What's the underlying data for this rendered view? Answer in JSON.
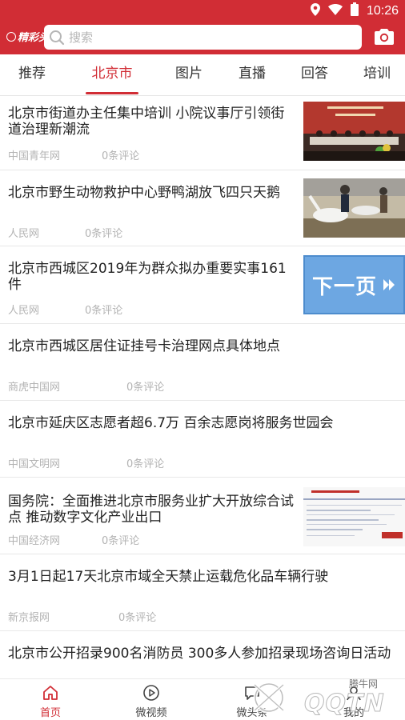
{
  "status_bar": {
    "time": "10:26"
  },
  "header": {
    "logo_text": "精彩头条",
    "search_placeholder": "搜索"
  },
  "tabs": [
    {
      "label": "推荐",
      "active": false
    },
    {
      "label": "北京市",
      "active": true
    },
    {
      "label": "图片",
      "active": false
    },
    {
      "label": "直播",
      "active": false
    },
    {
      "label": "回答",
      "active": false
    },
    {
      "label": "培训",
      "active": false
    }
  ],
  "news": [
    {
      "title": "北京市街道办主任集中培训 小院议事厅引领街道治理新潮流",
      "source": "中国青年网",
      "comments": "0条评论",
      "thumb": "meeting-photo"
    },
    {
      "title": "北京市野生动物救护中心野鸭湖放飞四只天鹅",
      "source": "人民网",
      "comments": "0条评论",
      "thumb": "swans-photo"
    },
    {
      "title": "北京市西城区2019年为群众拟办重要实事161件",
      "source": "人民网",
      "comments": "0条评论",
      "thumb": "next-page-banner",
      "thumb_text": "下一页"
    },
    {
      "title": "北京市西城区居住证挂号卡治理网点具体地点",
      "source": "商虎中国网",
      "comments": "0条评论"
    },
    {
      "title": "北京市延庆区志愿者超6.7万 百余志愿岗将服务世园会",
      "source": "中国文明网",
      "comments": "0条评论"
    },
    {
      "title": "国务院：全面推进北京市服务业扩大开放综合试点 推动数字文化产业出口",
      "source": "中国经济网",
      "comments": "0条评论",
      "thumb": "document-scan"
    },
    {
      "title": "3月1日起17天北京市域全天禁止运载危化品车辆行驶",
      "source": "新京报网",
      "comments": "0条评论"
    },
    {
      "title": "北京市公开招录900名消防员 300多人参加招录现场咨询日活动",
      "source": "",
      "comments": ""
    }
  ],
  "bottom_nav": [
    {
      "label": "首页",
      "icon": "home-icon",
      "active": true
    },
    {
      "label": "微视频",
      "icon": "play-circle-icon",
      "active": false
    },
    {
      "label": "微头条",
      "icon": "chat-icon",
      "active": false
    },
    {
      "label": "我的",
      "icon": "person-icon",
      "active": false
    }
  ],
  "watermark": {
    "brand": "QQTN",
    "site": "腾牛网"
  },
  "colors": {
    "brand_red": "#d12d35",
    "meta_gray": "#b3b3b3",
    "text": "#222222"
  }
}
